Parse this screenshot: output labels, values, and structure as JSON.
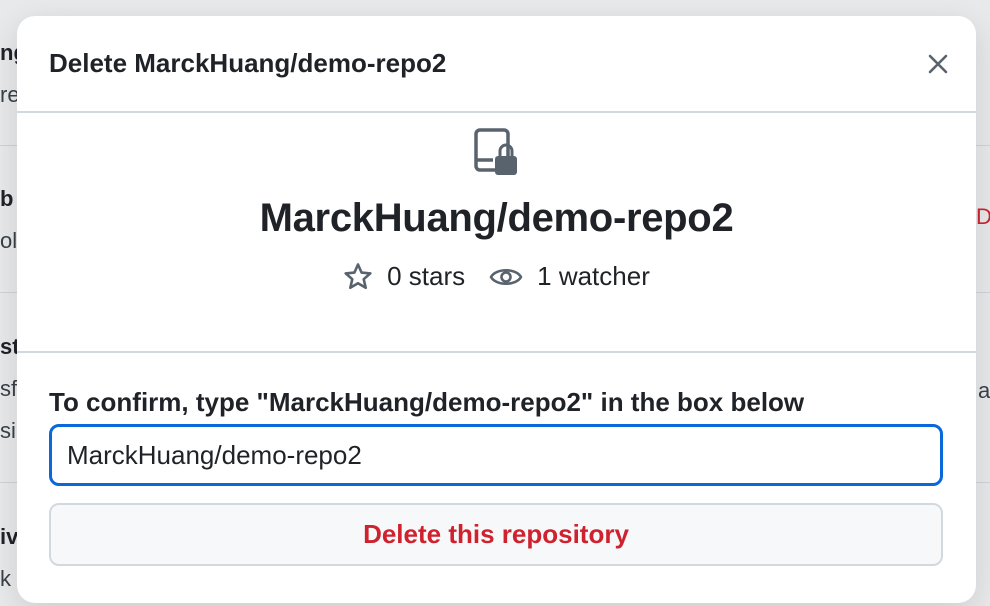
{
  "background": {
    "fragments": [
      "ng",
      "re",
      "b",
      "ol",
      "st",
      "sf",
      "si",
      "iv",
      "k t",
      "Dis",
      "a"
    ]
  },
  "modal": {
    "title": "Delete MarckHuang/demo-repo2",
    "close_icon": "close-icon",
    "repo_icon": "repo-locked-icon",
    "repo_name": "MarckHuang/demo-repo2",
    "stars_label": "0 stars",
    "watchers_label": "1 watcher",
    "confirm_label": "To confirm, type \"MarckHuang/demo-repo2\" in the box below",
    "confirm_value": "MarckHuang/demo-repo2",
    "delete_button_label": "Delete this repository"
  },
  "colors": {
    "danger": "#cf222e",
    "focus": "#0969da",
    "border": "#d1d9e0"
  }
}
